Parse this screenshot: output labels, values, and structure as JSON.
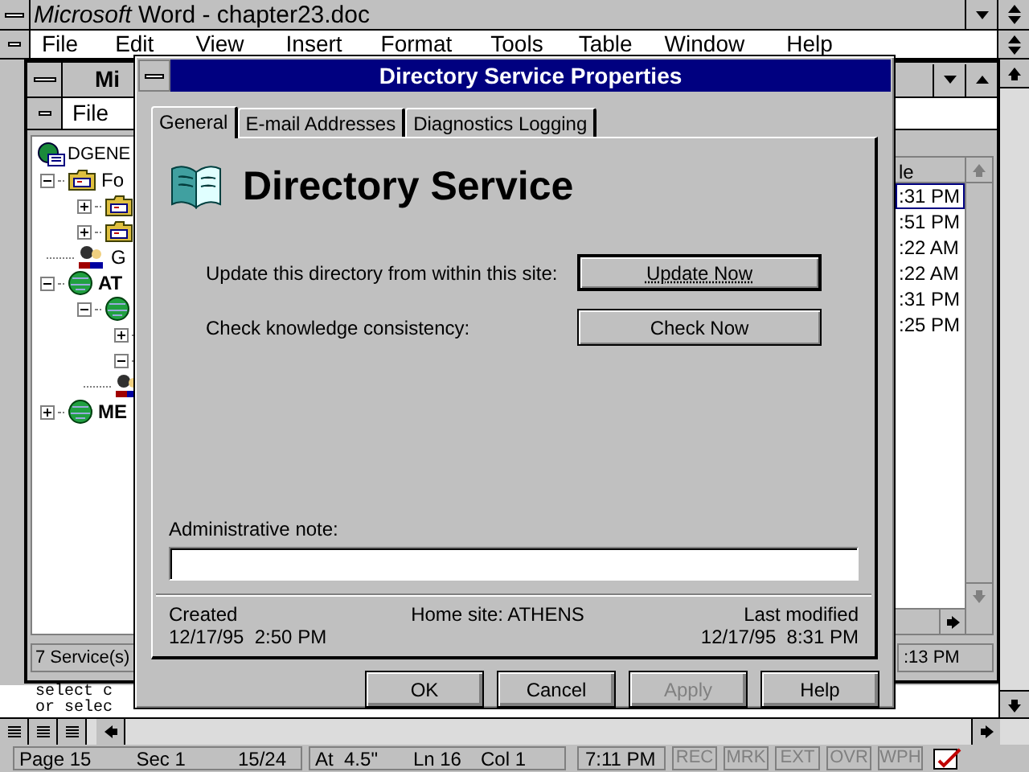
{
  "word": {
    "title": "*Microsoft* Word - chapter23.doc",
    "menu": [
      "File",
      "Edit",
      "View",
      "Insert",
      "Format",
      "Tools",
      "Table",
      "Window",
      "Help"
    ],
    "document_lines": [
      "select c",
      "or selec"
    ],
    "status_bar": {
      "page": "Page 15",
      "section": "Sec 1",
      "pages": "15/24",
      "position": "At  4.5\"",
      "line": "Ln 16",
      "column": "Col 1",
      "time": "7:11 PM",
      "indicators": [
        {
          "label": "REC",
          "on": false
        },
        {
          "label": "MRK",
          "on": false
        },
        {
          "label": "EXT",
          "on": false
        },
        {
          "label": "OVR",
          "on": false
        },
        {
          "label": "WPH",
          "on": false
        }
      ]
    }
  },
  "admin_window": {
    "title": "Mi",
    "menu": [
      "File"
    ],
    "tree": [
      {
        "label": "DGENE",
        "kind": "site",
        "children": [
          {
            "label": "Fo",
            "kind": "folder",
            "expanded": true,
            "children": [
              {
                "kind": "folder",
                "expanded": false
              },
              {
                "kind": "folder",
                "expanded": false
              }
            ]
          },
          {
            "label": "G",
            "kind": "people"
          },
          {
            "label": "AT",
            "kind": "globe",
            "expanded": true,
            "children": [
              {
                "kind": "globe",
                "expanded": true,
                "children": [
                  {
                    "expanded": false
                  },
                  {
                    "expanded": true
                  }
                ]
              },
              {
                "kind": "people"
              }
            ]
          },
          {
            "label": "ME",
            "kind": "globe",
            "expanded": false
          }
        ]
      }
    ],
    "list": {
      "column": "le",
      "rows": [
        {
          "text": ":31 PM",
          "selected": true
        },
        {
          "text": ":51 PM",
          "selected": false
        },
        {
          "text": ":22 AM",
          "selected": false
        },
        {
          "text": ":22 AM",
          "selected": false
        },
        {
          "text": ":31 PM",
          "selected": false
        },
        {
          "text": ":25 PM",
          "selected": false
        }
      ]
    },
    "status": {
      "count": "7 Service(s)",
      "time": ":13 PM"
    }
  },
  "dialog": {
    "title": "Directory Service Properties",
    "tabs": [
      {
        "label": "General",
        "selected": true
      },
      {
        "label": "E-mail Addresses",
        "selected": false
      },
      {
        "label": "Diagnostics Logging",
        "selected": false
      }
    ],
    "heading": "Directory Service",
    "actions": [
      {
        "label": "Update this directory from within this site:",
        "button": "Update Now",
        "default": true
      },
      {
        "label": "Check knowledge consistency:",
        "button": "Check Now",
        "default": false
      }
    ],
    "note": {
      "label": "Administrative note:"
    },
    "created": {
      "label": "Created",
      "value": "12/17/95  2:50 PM"
    },
    "home_site": "Home site: ATHENS",
    "modified": {
      "label": "Last modified",
      "value": "12/17/95  8:31 PM"
    },
    "buttons": [
      {
        "label": "OK",
        "disabled": false
      },
      {
        "label": "Cancel",
        "disabled": false
      },
      {
        "label": "Apply",
        "disabled": true
      },
      {
        "label": "Help",
        "disabled": false
      }
    ]
  }
}
